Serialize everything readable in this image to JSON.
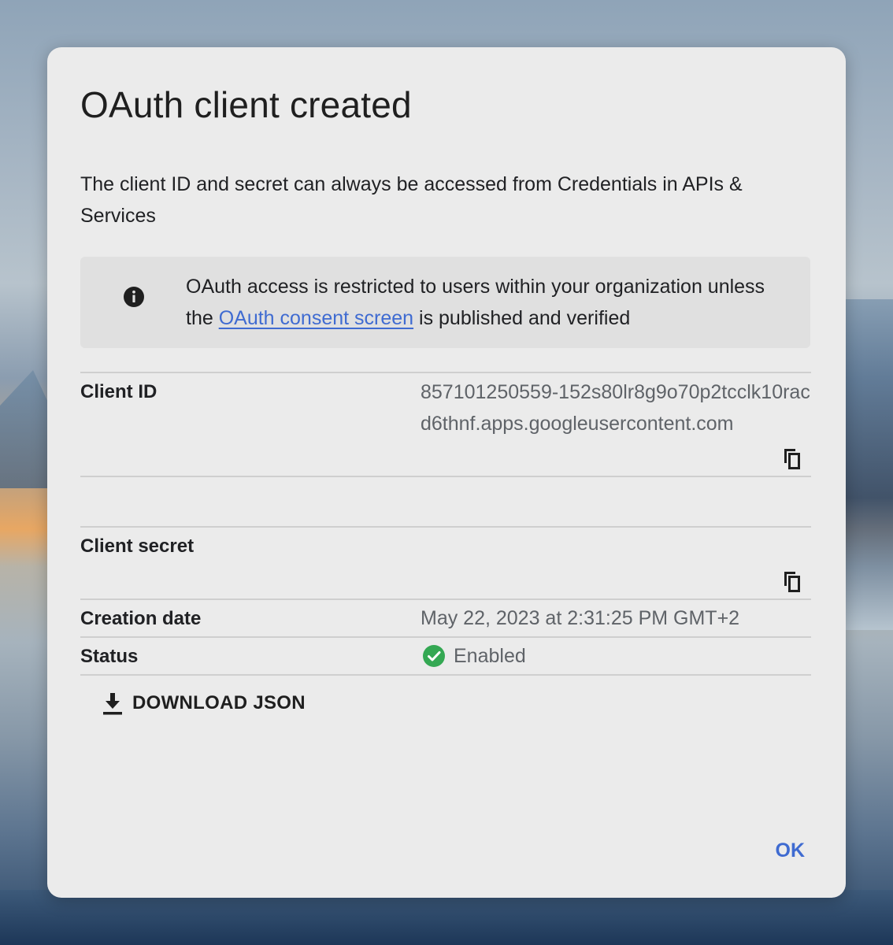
{
  "dialog": {
    "title": "OAuth client created",
    "description": "The client ID and secret can always be accessed from Credentials in APIs & Services",
    "notice": {
      "icon": "info-icon",
      "text_before": "OAuth access is restricted to users within your organization unless the ",
      "link_text": "OAuth consent screen",
      "text_after": " is published and verified"
    },
    "fields": {
      "client_id": {
        "label": "Client ID",
        "value": "857101250559-152s80lr8g9o70p2tcclk10racd6thnf.apps.googleusercontent.com",
        "copy_icon": "copy-icon"
      },
      "client_secret": {
        "label": "Client secret",
        "value": "",
        "copy_icon": "copy-icon"
      },
      "creation_date": {
        "label": "Creation date",
        "value": "May 22, 2023 at 2:31:25 PM GMT+2"
      },
      "status": {
        "label": "Status",
        "value": "Enabled",
        "icon": "check-circle-icon",
        "color": "#34a853"
      }
    },
    "download_label": "DOWNLOAD JSON",
    "ok_label": "OK",
    "accent_color": "#3f6bd1"
  }
}
